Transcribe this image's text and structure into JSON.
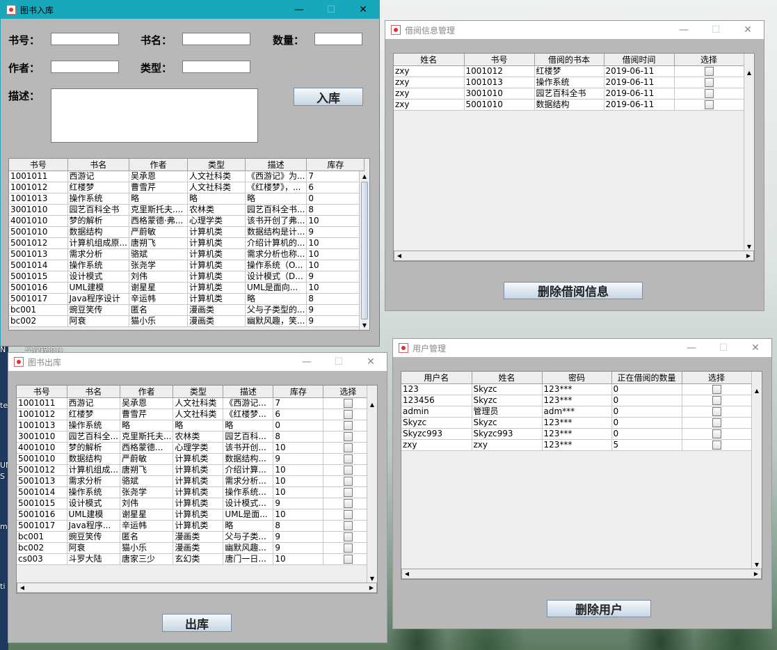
{
  "desktop": {
    "labels": [
      "N",
      "学课程设计",
      "te",
      "UN",
      "S b",
      "m",
      "ti"
    ]
  },
  "win1": {
    "title": "图书入库",
    "labels": {
      "bookno": "书号：",
      "bookname": "书名：",
      "qty": "数量：",
      "author": "作者：",
      "type": "类型：",
      "desc": "描述："
    },
    "inputs": {
      "bookno": "",
      "bookname": "",
      "qty": "",
      "author": "",
      "type": "",
      "desc": ""
    },
    "submit": "入库",
    "columns": [
      "书号",
      "书名",
      "作者",
      "类型",
      "描述",
      "库存"
    ],
    "rows": [
      [
        "1001011",
        "西游记",
        "吴承恩",
        "人文社科类",
        "《西游记》为...",
        "7"
      ],
      [
        "1001012",
        "红楼梦",
        "曹雪芹",
        "人文社科类",
        "《红楼梦》，...",
        "6"
      ],
      [
        "1001013",
        "操作系统",
        "略",
        "略",
        "略",
        "0"
      ],
      [
        "3001010",
        "园艺百科全书",
        "克里斯托夫....",
        "农林类",
        "园艺百科全书...",
        "8"
      ],
      [
        "4001010",
        "梦的解析",
        "西格蒙德·弗...",
        "心理学类",
        "该书开创了弗...",
        "10"
      ],
      [
        "5001010",
        "数据结构",
        "严蔚敏",
        "计算机类",
        "数据结构是计...",
        "9"
      ],
      [
        "5001012",
        "计算机组成原...",
        "唐朔飞",
        "计算机类",
        "介绍计算机的...",
        "10"
      ],
      [
        "5001013",
        "需求分析",
        "骆斌",
        "计算机类",
        "需求分析也称...",
        "10"
      ],
      [
        "5001014",
        "操作系统",
        "张尧学",
        "计算机类",
        "操作系统（O...",
        "10"
      ],
      [
        "5001015",
        "设计模式",
        "刘伟",
        "计算机类",
        "设计模式（D...",
        "9"
      ],
      [
        "5001016",
        "UML建模",
        "谢星星",
        "计算机类",
        "UML是面向...",
        "10"
      ],
      [
        "5001017",
        "Java程序设计",
        "辛运帏",
        "计算机类",
        "略",
        "8"
      ],
      [
        "bc001",
        "豌豆笑传",
        "匿名",
        "漫画类",
        "父与子类型的...",
        "9"
      ],
      [
        "bc002",
        "阿衰",
        "猫小乐",
        "漫画类",
        "幽默风趣，笑...",
        "9"
      ]
    ]
  },
  "win2": {
    "title": "借阅信息管理",
    "columns": [
      "姓名",
      "书号",
      "借阅的书本",
      "借阅时间",
      "选择"
    ],
    "rows": [
      [
        "zxy",
        "1001012",
        "红楼梦",
        "2019-06-11"
      ],
      [
        "zxy",
        "1001013",
        "操作系统",
        "2019-06-11"
      ],
      [
        "zxy",
        "3001010",
        "园艺百科全书",
        "2019-06-11"
      ],
      [
        "zxy",
        "5001010",
        "数据结构",
        "2019-06-11"
      ]
    ],
    "button": "删除借阅信息"
  },
  "win3": {
    "title": "图书出库",
    "columns": [
      "书号",
      "书名",
      "作者",
      "类型",
      "描述",
      "库存",
      "选择"
    ],
    "rows": [
      [
        "1001011",
        "西游记",
        "吴承恩",
        "人文社科类",
        "《西游记...",
        "7"
      ],
      [
        "1001012",
        "红楼梦",
        "曹雪芹",
        "人文社科类",
        "《红楼梦...",
        "6"
      ],
      [
        "1001013",
        "操作系统",
        "略",
        "略",
        "略",
        "0"
      ],
      [
        "3001010",
        "园艺百科全...",
        "克里斯托夫...",
        "农林类",
        "园艺百科...",
        "8"
      ],
      [
        "4001010",
        "梦的解析",
        "西格蒙德...",
        "心理学类",
        "该书开创...",
        "10"
      ],
      [
        "5001010",
        "数据结构",
        "严蔚敏",
        "计算机类",
        "数据结构...",
        "9"
      ],
      [
        "5001012",
        "计算机组成...",
        "唐朔飞",
        "计算机类",
        "介绍计算...",
        "10"
      ],
      [
        "5001013",
        "需求分析",
        "骆斌",
        "计算机类",
        "需求分析...",
        "10"
      ],
      [
        "5001014",
        "操作系统",
        "张尧学",
        "计算机类",
        "操作系统...",
        "10"
      ],
      [
        "5001015",
        "设计模式",
        "刘伟",
        "计算机类",
        "设计模式...",
        "9"
      ],
      [
        "5001016",
        "UML建模",
        "谢星星",
        "计算机类",
        "UML是面...",
        "10"
      ],
      [
        "5001017",
        "Java程序...",
        "辛运帏",
        "计算机类",
        "略",
        "8"
      ],
      [
        "bc001",
        "豌豆笑传",
        "匿名",
        "漫画类",
        "父与子类...",
        "9"
      ],
      [
        "bc002",
        "阿衰",
        "猫小乐",
        "漫画类",
        "幽默风趣...",
        "9"
      ],
      [
        "cs003",
        "斗罗大陆",
        "唐家三少",
        "玄幻类",
        "唐门一日...",
        "10"
      ]
    ],
    "button": "出库"
  },
  "win4": {
    "title": "用户管理",
    "columns": [
      "用户名",
      "姓名",
      "密码",
      "正在借阅的数量",
      "选择"
    ],
    "rows": [
      [
        "123",
        "Skyzc",
        "123***",
        "0"
      ],
      [
        "123456",
        "Skyzc",
        "123***",
        "0"
      ],
      [
        "admin",
        "管理员",
        "adm***",
        "0"
      ],
      [
        "Skyzc",
        "Skyzc",
        "123***",
        "0"
      ],
      [
        "Skyzc993",
        "Skyzc993",
        "123***",
        "0"
      ],
      [
        "zxy",
        "zxy",
        "123***",
        "5"
      ]
    ],
    "button": "删除用户"
  },
  "window_controls": {
    "minimize": "—",
    "maximize": "☐",
    "close": "✕"
  }
}
